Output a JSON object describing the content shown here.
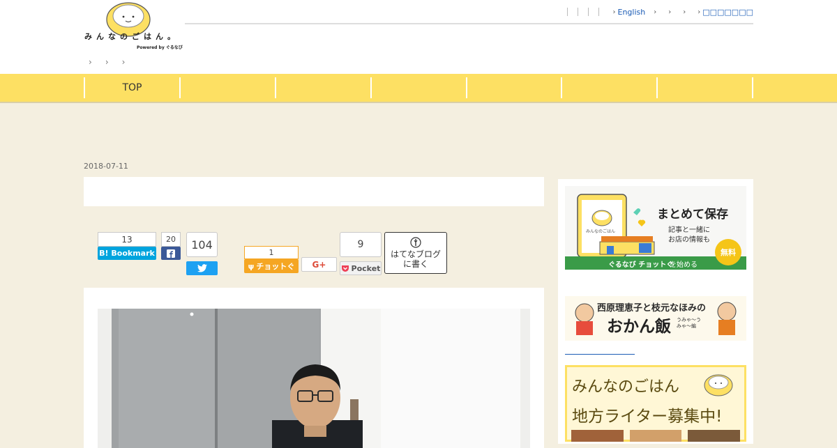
{
  "logo": {
    "text": "みんなのごはん。",
    "powered": "Powered by ぐるなび"
  },
  "top_links": [
    {
      "label": ""
    },
    {
      "label": ""
    },
    {
      "label": ""
    },
    {
      "label": ""
    },
    {
      "label": "English"
    },
    {
      "label": ""
    },
    {
      "label": ""
    },
    {
      "label": ""
    },
    {
      "label": "□□□□□□□"
    }
  ],
  "nav": {
    "items": [
      "TOP",
      "",
      "",
      "",
      "",
      "",
      "",
      ""
    ]
  },
  "article": {
    "date": "2018-07-11",
    "title": ""
  },
  "share": {
    "hatena_count": "13",
    "hatena_label": "B! Bookmark",
    "fb_count": "20",
    "tw_count": "104",
    "chotto_count": "1",
    "chotto_label": "チョットぐ",
    "gplus_label": "G+",
    "pocket_count": "9",
    "pocket_label": "Pocket",
    "hatenablog_label_1": "はてなブログ",
    "hatenablog_label_2": "に書く"
  },
  "sidebar": {
    "banner1_title": "まとめて保存",
    "banner1_sub_1": "記事と一緒に",
    "banner1_sub_2": "お店の情報も",
    "banner1_badge": "無料",
    "banner1_foot_brand": "ぐるなび チョットぐ",
    "banner1_foot_text": "を始める",
    "banner1_app_name": "みんなのごはん",
    "banner2_title": "西原理恵子と枝元なほみの",
    "banner2_big": "おかん飯",
    "banner2_small": "うみゃ〜うみゃ〜編",
    "banner3_line1": "みんなのごはん",
    "banner3_line2": "地方ライター募集中!"
  },
  "colors": {
    "nav_yellow": "#fde063",
    "hatena_blue": "#00a4de",
    "fb_blue": "#3b5998",
    "tw_blue": "#1da1f2",
    "chotto_orange": "#f5a623",
    "gplus_red": "#dd4b39",
    "pocket_red": "#ee4056",
    "link_blue": "#1a5bb5"
  }
}
